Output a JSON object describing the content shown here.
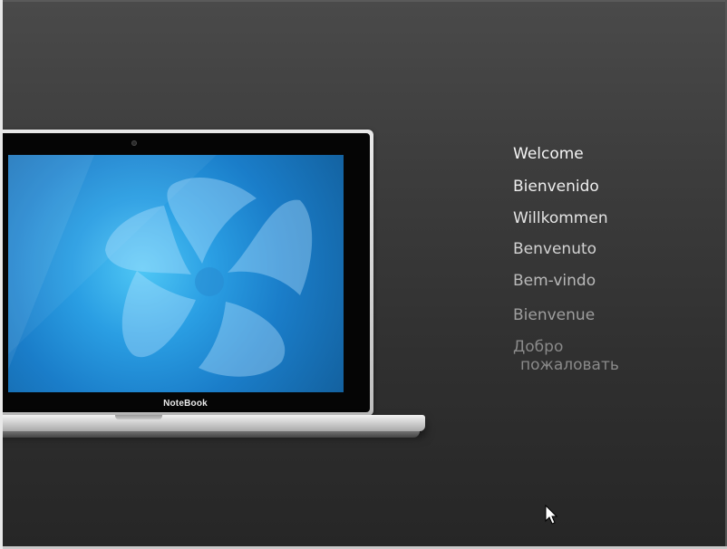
{
  "device": {
    "brand_label": "NoteBook"
  },
  "welcome": {
    "items": [
      {
        "text": "Welcome",
        "color": "#f4f4f4"
      },
      {
        "text": "Bienvenido",
        "color": "#eeeeee"
      },
      {
        "text": "Willkommen",
        "color": "#e4e4e4"
      },
      {
        "text": "Benvenuto",
        "color": "#d2d2d2"
      },
      {
        "text": "Bem-vindo",
        "color": "#b9b9b9"
      },
      {
        "text": "Bienvenue",
        "color": "#9e9e9e"
      },
      {
        "line1": "Добро",
        "line2": "пожаловать",
        "color": "#8a8a8a"
      }
    ]
  },
  "icons": {
    "cursor": "mouse-pointer-icon",
    "wallpaper_logo": "swirl-logo-icon"
  },
  "colors": {
    "background_top": "#4a4a4a",
    "background_bottom": "#262626",
    "screen_blue": "#1a7dc9"
  }
}
